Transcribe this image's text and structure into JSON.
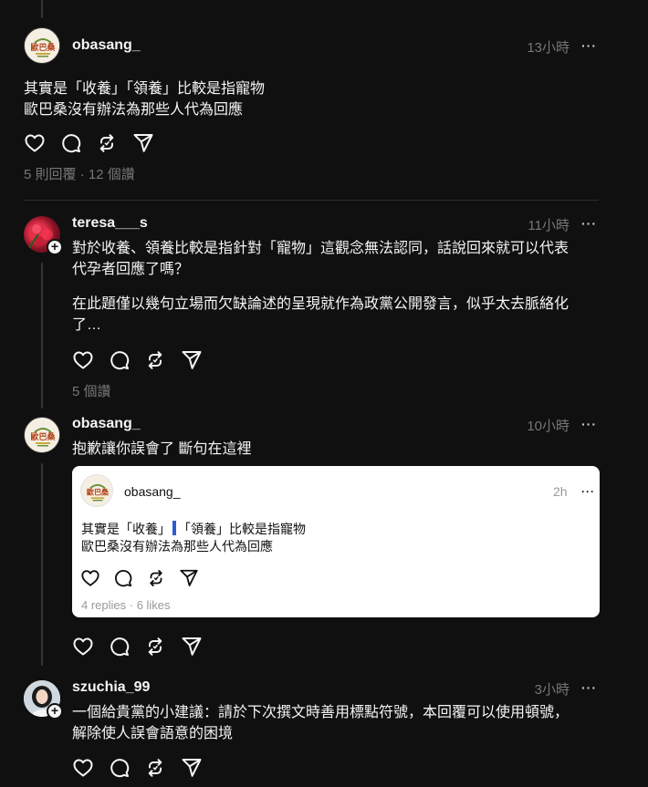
{
  "posts": [
    {
      "username": "obasang_",
      "time": "13小時",
      "more": "···",
      "lines": [
        "其實是「收養」「領養」比較是指寵物",
        "歐巴桑沒有辦法為那些人代為回應"
      ],
      "stats": "5 則回覆 · 12 個讚"
    },
    {
      "username": "teresa___s",
      "time": "11小時",
      "more": "···",
      "lines": [
        "對於收養、領養比較是指針對「寵物」這觀念無法認同，話說回來就可以代表",
        "代孕者回應了嗎？"
      ],
      "lines2": [
        "在此題僅以幾句立場而欠缺論述的呈現就作為政黨公開發言，似乎太去脈絡化",
        "了…"
      ],
      "stats": "5 個讚"
    },
    {
      "username": "obasang_",
      "time": "10小時",
      "more": "···",
      "lines": [
        "抱歉讓你誤會了 斷句在這裡"
      ],
      "quote": {
        "username": "obasang_",
        "time": "2h",
        "more": "···",
        "line1_a": "其實是「收養」",
        "line1_b": "「領養」比較是指寵物",
        "line2": "歐巴桑沒有辦法為那些人代為回應",
        "stats": "4 replies · 6 likes"
      }
    },
    {
      "username": "szuchia_99",
      "time": "3小時",
      "more": "···",
      "lines": [
        "一個給貴黨的小建議：請於下次撰文時善用標點符號，本回覆可以使用頓號，",
        "解除使人誤會語意的困境"
      ]
    }
  ],
  "icons": [
    "heart-icon",
    "comment-icon",
    "repost-icon",
    "share-icon"
  ],
  "badge": "+"
}
